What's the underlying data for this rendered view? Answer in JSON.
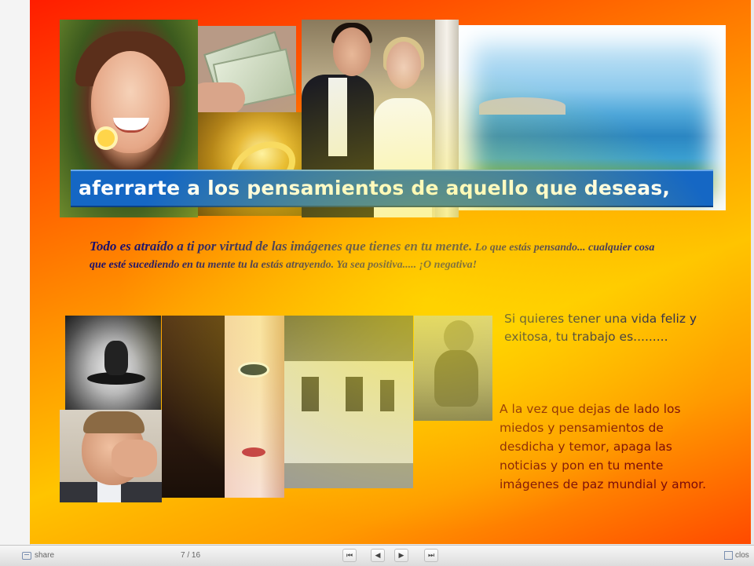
{
  "slide": {
    "caption": "aferrarte a los pensamientos de aquello que deseas,",
    "paragraph_lead": "Todo es  atraído a ti por virtud de las imágenes que tienes en tu mente.",
    "paragraph_rest": " Lo que estás pensando... cualquier cosa que esté sucediendo en tu mente tu la estás atrayendo. Ya sea positiva..... ¡O negativa!",
    "side_text_1": "Si quieres tener una vida feliz y exitosa, tu trabajo es.........",
    "side_text_2": "A la vez que dejas de lado los miedos y pensamientos de desdicha y temor, apaga las noticias y pon en tu mente imágenes de paz mundial y amor."
  },
  "controls": {
    "share_label": "share",
    "page_indicator": "7 / 16",
    "first_symbol": "⏮",
    "prev_symbol": "◀",
    "next_symbol": "▶",
    "last_symbol": "⏭",
    "close_label": "clos"
  },
  "colors": {
    "caption_bg": "#1567c4",
    "paragraph_text": "#1a0f6e",
    "side_text_2": "#7a0a0a"
  },
  "icons": [
    "share-icon",
    "first-page-icon",
    "prev-page-icon",
    "next-page-icon",
    "last-page-icon",
    "close-icon"
  ]
}
